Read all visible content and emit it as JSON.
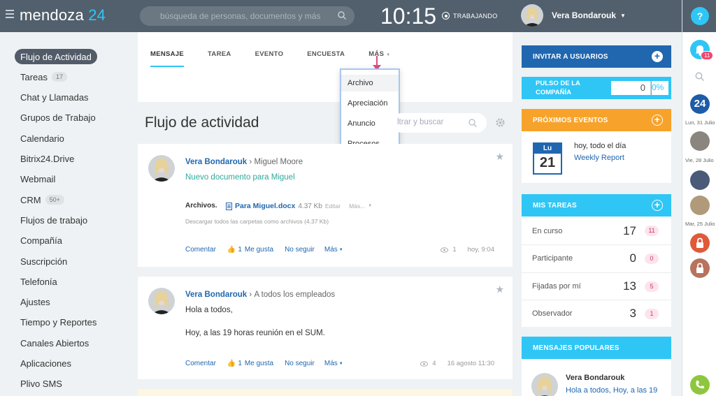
{
  "header": {
    "logo_text": "mendoza",
    "logo_number": "24",
    "search_placeholder": "búsqueda de personas, documentos y más",
    "clock": "10:15",
    "work_status": "TRABAJANDO",
    "user_name": "Vera Bondarouk",
    "help_label": "?"
  },
  "sidebar": {
    "items": [
      {
        "label": "Flujo de Actividad",
        "active": true
      },
      {
        "label": "Tareas",
        "badge": "17"
      },
      {
        "label": "Chat y Llamadas"
      },
      {
        "label": "Grupos de Trabajo"
      },
      {
        "label": "Calendario"
      },
      {
        "label": "Bitrix24.Drive"
      },
      {
        "label": "Webmail"
      },
      {
        "label": "CRM",
        "badge": "50+"
      },
      {
        "label": "Flujos de trabajo"
      },
      {
        "label": "Compañía"
      },
      {
        "label": "Suscripción"
      },
      {
        "label": "Telefonía"
      },
      {
        "label": "Ajustes"
      },
      {
        "label": "Tiempo y Reportes"
      },
      {
        "label": "Canales Abiertos"
      },
      {
        "label": "Aplicaciones"
      },
      {
        "label": "Plivo SMS"
      }
    ]
  },
  "composer": {
    "tabs": [
      "MENSAJE",
      "TAREA",
      "EVENTO",
      "ENCUESTA",
      "MÁS"
    ],
    "dropdown": [
      "Archivo",
      "Apreciación",
      "Anuncio",
      "Procesos"
    ]
  },
  "feed": {
    "title": "Flujo de actividad",
    "filter_placeholder": "ltrar y buscar",
    "posts": [
      {
        "author": "Vera Bondarouk",
        "recipient": "Miguel Moore",
        "subtitle": "Nuevo documento para Miguel",
        "files_label": "Archivos.",
        "file_name": "Para Miguel.docx",
        "file_size": "4.37 Kb",
        "file_edit": "Editar",
        "file_more": "Más...",
        "download_all": "Descargar todos las carpetas como archivos (4.37 Kb)",
        "comment": "Comentar",
        "likes": "1",
        "like_label": "Me gusta",
        "unfollow": "No seguir",
        "more": "Más",
        "views": "1",
        "time": "hoy, 9:04"
      },
      {
        "author": "Vera Bondarouk",
        "recipient": "A todos los empleados",
        "line1": "Hola a todos,",
        "line2": "Hoy, a las 19 horas reunión en el SUM.",
        "comment": "Comentar",
        "likes": "1",
        "like_label": "Me gusta",
        "unfollow": "No seguir",
        "more": "Más",
        "views": "4",
        "time": "16 agosto 11:30"
      }
    ]
  },
  "right": {
    "invite": "INVITAR A USUARIOS",
    "pulse_label": "PULSO DE LA COMPAÑÍA",
    "pulse_value": "0",
    "pulse_percent": "0%",
    "events_title": "PRÓXIMOS EVENTOS",
    "event_day_abbr": "Lu",
    "event_day": "21",
    "event_when": "hoy, todo el día",
    "event_name": "Weekly Report",
    "tasks_title": "MIS TAREAS",
    "tasks": [
      {
        "label": "En curso",
        "value": "17",
        "count": "11"
      },
      {
        "label": "Participante",
        "value": "0",
        "count": "0"
      },
      {
        "label": "Fijadas por mí",
        "value": "13",
        "count": "5"
      },
      {
        "label": "Observador",
        "value": "3",
        "count": "1"
      }
    ],
    "popular_title": "MENSAJES POPULARES",
    "popular_author": "Vera Bondarouk",
    "popular_text": "Hola a todos, Hoy, a las 19"
  },
  "rail": {
    "notif_count": "11",
    "logo": "24",
    "dates": [
      "Lun, 31 Julio",
      "Vie, 28 Julio",
      "Mar, 25 Julio"
    ]
  },
  "colors": {
    "accent": "#2fc6f6",
    "topbar": "#52606d",
    "events": "#f7a32b",
    "link": "#2067b0",
    "green": "#8ec63f"
  }
}
